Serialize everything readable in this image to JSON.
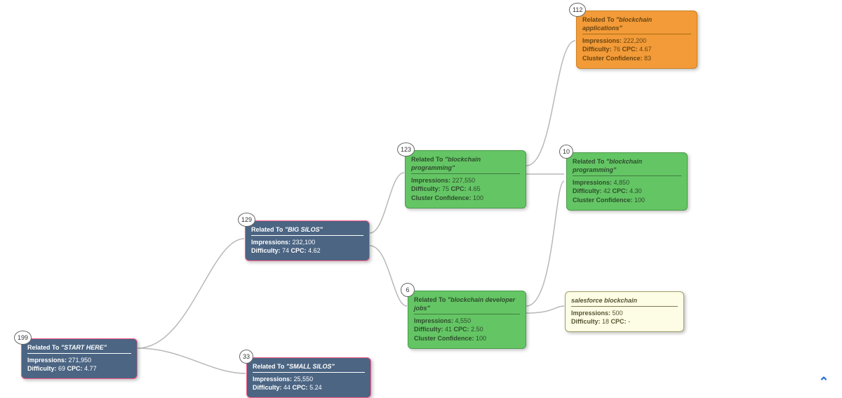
{
  "chart_data": {
    "type": "tree-diagram",
    "description": "Topic cluster / keyword silo map",
    "edges": [
      [
        "start-here",
        "big-silos"
      ],
      [
        "start-here",
        "small-silos"
      ],
      [
        "big-silos",
        "blockchain-programming-123"
      ],
      [
        "big-silos",
        "blockchain-developer-jobs"
      ],
      [
        "blockchain-programming-123",
        "blockchain-applications"
      ],
      [
        "blockchain-programming-123",
        "blockchain-programming-10"
      ],
      [
        "blockchain-developer-jobs",
        "blockchain-programming-10"
      ],
      [
        "blockchain-developer-jobs",
        "salesforce-blockchain"
      ]
    ]
  },
  "labels": {
    "related_to": "Related To",
    "impressions": "Impressions:",
    "difficulty": "Difficulty:",
    "cpc": "CPC:",
    "confidence": "Cluster Confidence:"
  },
  "nodes": {
    "start": {
      "badge": "199",
      "keyword": "\"START HERE\"",
      "impressions": "271,950",
      "difficulty": "69",
      "cpc": "4.77"
    },
    "big": {
      "badge": "129",
      "keyword": "\"BIG SILOS\"",
      "impressions": "232,100",
      "difficulty": "74",
      "cpc": "4.62"
    },
    "small": {
      "badge": "33",
      "keyword": "\"SMALL SILOS\"",
      "impressions": "25,550",
      "difficulty": "44",
      "cpc": "5.24"
    },
    "bp123": {
      "badge": "123",
      "keyword": "\"blockchain programming\"",
      "impressions": "227,550",
      "difficulty": "75",
      "cpc": "4.65",
      "confidence": "100"
    },
    "devjobs": {
      "badge": "6",
      "keyword": "\"blockchain developer jobs\"",
      "impressions": "4,550",
      "difficulty": "41",
      "cpc": "2.50",
      "confidence": "100"
    },
    "apps": {
      "badge": "112",
      "keyword": "\"blockchain applications\"",
      "impressions": "222,200",
      "difficulty": "76",
      "cpc": "4.67",
      "confidence": "83"
    },
    "bp10": {
      "badge": "10",
      "keyword": "\"blockchain programming\"",
      "impressions": "4,850",
      "difficulty": "42",
      "cpc": "4.30",
      "confidence": "100"
    },
    "sf": {
      "title": "salesforce blockchain",
      "impressions": "500",
      "difficulty": "18",
      "cpc": "-"
    }
  }
}
